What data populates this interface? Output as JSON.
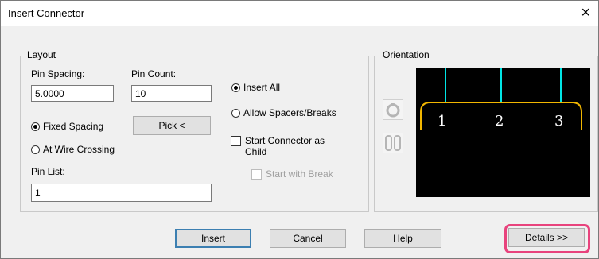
{
  "window": {
    "title": "Insert Connector",
    "close_glyph": "×"
  },
  "layout_group": {
    "legend": "Layout",
    "pin_spacing": {
      "label": "Pin Spacing:",
      "value": "5.0000"
    },
    "pin_count": {
      "label": "Pin Count:",
      "value": "10"
    },
    "fixed_spacing": {
      "label": "Fixed Spacing",
      "selected": true
    },
    "at_wire_crossing": {
      "label": "At Wire Crossing",
      "selected": false
    },
    "pick_button": "Pick <",
    "pin_list": {
      "label": "Pin List:",
      "value": "1"
    },
    "insert_all": {
      "label": "Insert All",
      "selected": true
    },
    "allow_spacers": {
      "label": "Allow Spacers/Breaks",
      "selected": false
    },
    "start_as_child": {
      "label_line1": "Start Connector as",
      "label_line2": "Child",
      "checked": false
    },
    "start_with_break": {
      "label": "Start with Break",
      "checked": false,
      "disabled": true
    }
  },
  "orientation_group": {
    "legend": "Orientation",
    "pins": [
      "1",
      "2",
      "3"
    ],
    "tools": [
      "rotate-icon",
      "flip-icon"
    ]
  },
  "buttons": {
    "insert": "Insert",
    "cancel": "Cancel",
    "help": "Help",
    "details": "Details >>"
  },
  "colors": {
    "accent_highlight": "#e8437d",
    "preview_bg": "#000000",
    "pin_line": "#00e5e5",
    "connector_outline": "#f2b600",
    "pin_text": "#ffffff"
  }
}
